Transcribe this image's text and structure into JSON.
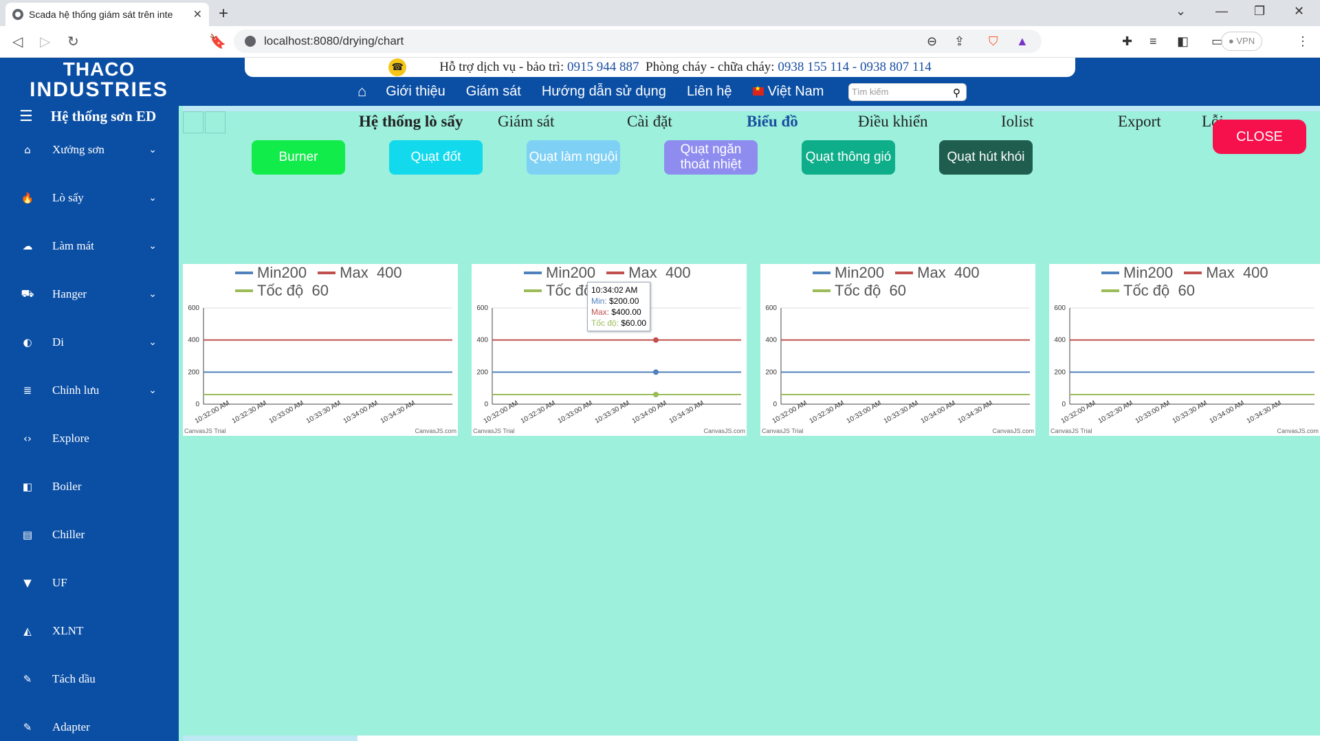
{
  "browser": {
    "tab_title": "Scada hệ thống giám sát trên inte",
    "url": "localhost:8080/drying/chart",
    "vpn_label": "● VPN"
  },
  "header": {
    "logo_line1": "THACO",
    "logo_line2": "INDUSTRIES",
    "support_prefix": "Hỗ trợ dịch vụ - bảo trì:",
    "support_phone": "0915 944 887",
    "fire_prefix": "Phòng cháy - chữa cháy:",
    "fire_phones": "0938 155 114 - 0938 807 114",
    "nav": [
      "Giới thiệu",
      "Giám sát",
      "Hướng dẫn sử dụng",
      "Liên hệ"
    ],
    "language": "Việt Nam",
    "search_placeholder": "Tìm kiếm"
  },
  "sidebar": {
    "title": "Hệ thống sơn ED",
    "items": [
      {
        "label": "Xưởng sơn",
        "icon": "home-icon",
        "glyph": "⌂",
        "expandable": true
      },
      {
        "label": "Lò sấy",
        "icon": "fire-icon",
        "glyph": "🔥",
        "expandable": true
      },
      {
        "label": "Làm mát",
        "icon": "cloud-icon",
        "glyph": "☁",
        "expandable": true
      },
      {
        "label": "Hanger",
        "icon": "hanger-icon",
        "glyph": "⛟",
        "expandable": true
      },
      {
        "label": "Di",
        "icon": "half-circle-icon",
        "glyph": "◐",
        "expandable": true
      },
      {
        "label": "Chỉnh lưu",
        "icon": "database-icon",
        "glyph": "≣",
        "expandable": true
      },
      {
        "label": "Explore",
        "icon": "code-icon",
        "glyph": "‹›",
        "expandable": false
      },
      {
        "label": "Boiler",
        "icon": "boiler-icon",
        "glyph": "◧",
        "expandable": false
      },
      {
        "label": "Chiller",
        "icon": "chiller-icon",
        "glyph": "▤",
        "expandable": false
      },
      {
        "label": "UF",
        "icon": "filter-icon",
        "glyph": "▼",
        "expandable": false
      },
      {
        "label": "XLNT",
        "icon": "paint-bucket-icon",
        "glyph": "◭",
        "expandable": false
      },
      {
        "label": "Tách dầu",
        "icon": "eraser-icon",
        "glyph": "✎",
        "expandable": false
      },
      {
        "label": "Adapter",
        "icon": "eraser-icon",
        "glyph": "✎",
        "expandable": false
      }
    ]
  },
  "subnav": {
    "title": "Hệ thống lò sấy",
    "items": [
      "Giám sát",
      "Cài đặt",
      "Biểu đồ",
      "Điều khiển",
      "Iolist",
      "Export",
      "Lỗi"
    ],
    "active": "Biểu đồ"
  },
  "fan_buttons": [
    {
      "label": "Burner",
      "color": "#12ec4a"
    },
    {
      "label": "Quạt đốt",
      "color": "#12d9ec"
    },
    {
      "label": "Quạt làm nguội",
      "color": "#7fd0f5"
    },
    {
      "label": "Quạt ngăn thoát nhiệt",
      "color": "#8f8cf0"
    },
    {
      "label": "Quạt thông gió",
      "color": "#0fae8a"
    },
    {
      "label": "Quạt hút khói",
      "color": "#1f5e4f"
    }
  ],
  "close_label": "CLOSE",
  "colors": {
    "min": "#4f81bc",
    "max": "#c0504e",
    "speed": "#9bbb58"
  },
  "chart_data": [
    {
      "type": "line",
      "x": [
        "10:32:00 AM",
        "10:32:30 AM",
        "10:33:00 AM",
        "10:33:30 AM",
        "10:34:00 AM",
        "10:34:30 AM"
      ],
      "ylim": [
        0,
        600
      ],
      "yticks": [
        0,
        200,
        400,
        600
      ],
      "series": [
        {
          "name": "Min200",
          "value": 200
        },
        {
          "name": "Max  400",
          "value": 400
        },
        {
          "name": "Tốc độ  60",
          "value": 60
        }
      ],
      "watermark_left": "CanvasJS Trial",
      "watermark_right": "CanvasJS.com"
    },
    {
      "type": "line",
      "x": [
        "10:32:00 AM",
        "10:32:30 AM",
        "10:33:00 AM",
        "10:33:30 AM",
        "10:34:00 AM",
        "10:34:30 AM"
      ],
      "ylim": [
        0,
        600
      ],
      "yticks": [
        0,
        200,
        400,
        600
      ],
      "series": [
        {
          "name": "Min200",
          "value": 200
        },
        {
          "name": "Max  400",
          "value": 400
        },
        {
          "name": "Tốc độ  60",
          "value": 60
        }
      ],
      "tooltip": {
        "time": "10:34:02 AM",
        "min": "$200.00",
        "max": "$400.00",
        "speed": "$60.00"
      },
      "watermark_left": "CanvasJS Trial",
      "watermark_right": "CanvasJS.com"
    },
    {
      "type": "line",
      "x": [
        "10:32:00 AM",
        "10:32:30 AM",
        "10:33:00 AM",
        "10:33:30 AM",
        "10:34:00 AM",
        "10:34:30 AM"
      ],
      "ylim": [
        0,
        600
      ],
      "yticks": [
        0,
        200,
        400,
        600
      ],
      "series": [
        {
          "name": "Min200",
          "value": 200
        },
        {
          "name": "Max  400",
          "value": 400
        },
        {
          "name": "Tốc độ  60",
          "value": 60
        }
      ],
      "watermark_left": "CanvasJS Trial",
      "watermark_right": "CanvasJS.com"
    },
    {
      "type": "line",
      "x": [
        "10:32:00 AM",
        "10:32:30 AM",
        "10:33:00 AM",
        "10:33:30 AM",
        "10:34:00 AM",
        "10:34:30 AM"
      ],
      "ylim": [
        0,
        600
      ],
      "yticks": [
        0,
        200,
        400,
        600
      ],
      "series": [
        {
          "name": "Min200",
          "value": 200
        },
        {
          "name": "Max  400",
          "value": 400
        },
        {
          "name": "Tốc độ  60",
          "value": 60
        }
      ],
      "watermark_left": "CanvasJS Trial",
      "watermark_right": "CanvasJS.com"
    }
  ]
}
